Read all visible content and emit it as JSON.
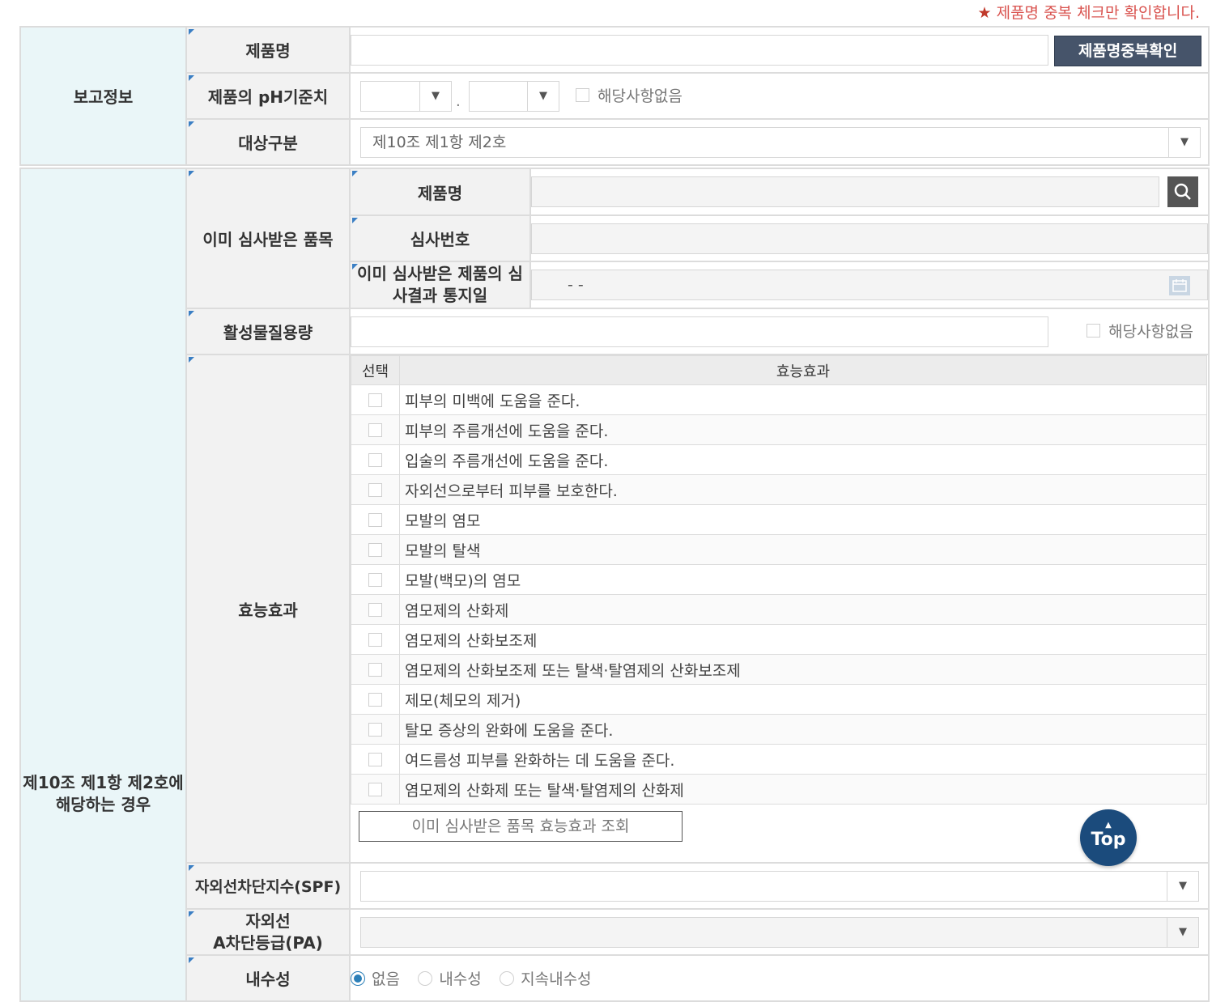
{
  "notice": {
    "star": "★",
    "text": "제품명 중복 체크만 확인합니다."
  },
  "report_section": {
    "title": "보고정보",
    "product_name": {
      "label": "제품명",
      "value": "",
      "check_button": "제품명중복확인"
    },
    "ph": {
      "label": "제품의 pH기준치",
      "sep": ".",
      "none_label": "해당사항없음"
    },
    "target": {
      "label": "대상구분",
      "selected": "제10조 제1항 제2호"
    }
  },
  "case_section": {
    "title": "제10조 제1항 제2호에 해당하는 경우",
    "already_reviewed": {
      "label": "이미 심사받은 품목",
      "product_name_label": "제품명",
      "review_no_label": "심사번호",
      "notice_date_label": "이미 심사받은 제품의 심사결과 통지일",
      "notice_date_value": "- -"
    },
    "active_amount": {
      "label": "활성물질용량",
      "none_label": "해당사항없음"
    },
    "efficacy": {
      "label": "효능효과",
      "col_select": "선택",
      "col_effect": "효능효과",
      "items": [
        "피부의 미백에 도움을 준다.",
        "피부의 주름개선에 도움을 준다.",
        "입술의 주름개선에 도움을 준다.",
        "자외선으로부터 피부를 보호한다.",
        "모발의 염모",
        "모발의 탈색",
        "모발(백모)의 염모",
        "염모제의 산화제",
        "염모제의 산화보조제",
        "염모제의 산화보조제 또는 탈색·탈염제의 산화보조제",
        "제모(체모의 제거)",
        "탈모 증상의 완화에 도움을 준다.",
        "여드름성 피부를 완화하는 데 도움을 준다.",
        "염모제의 산화제 또는 탈색·탈염제의 산화제"
      ],
      "lookup_button": "이미 심사받은 품목 효능효과 조회"
    },
    "spf": {
      "label": "자외선차단지수(SPF)"
    },
    "pa": {
      "label_line1": "자외선",
      "label_line2": "A차단등급(PA)"
    },
    "water": {
      "label": "내수성",
      "options": [
        "없음",
        "내수성",
        "지속내수성"
      ],
      "selected": "없음"
    }
  },
  "top_button": {
    "label": "Top"
  }
}
